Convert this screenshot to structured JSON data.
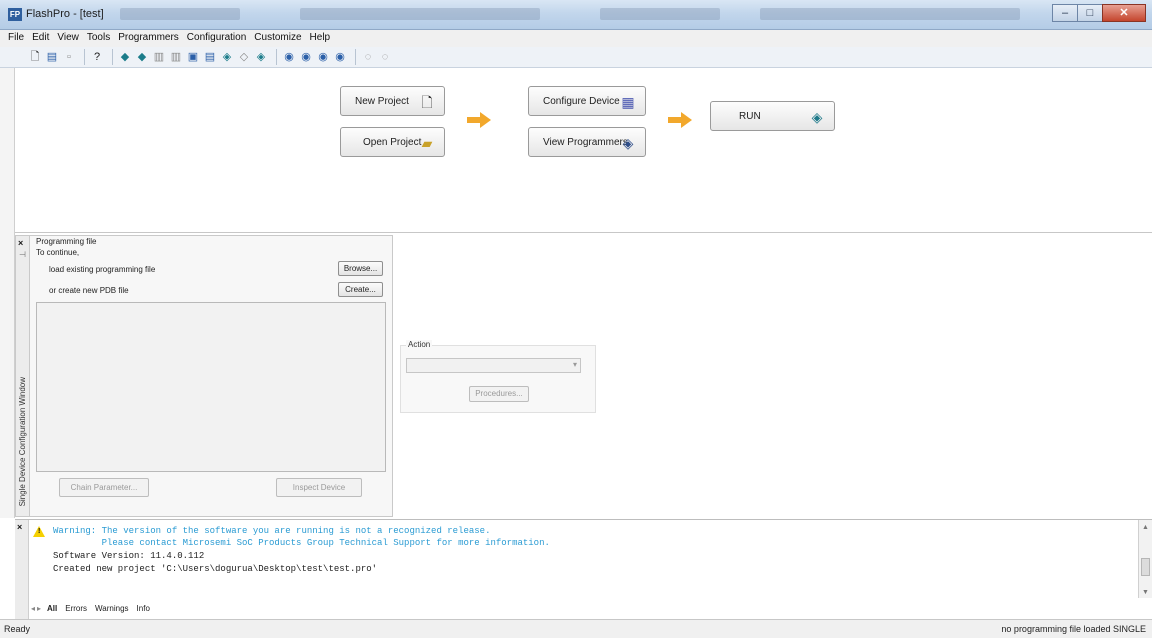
{
  "window": {
    "title": "FlashPro - [test]",
    "icon": "FP"
  },
  "menu": [
    "File",
    "Edit",
    "View",
    "Tools",
    "Programmers",
    "Configuration",
    "Customize",
    "Help"
  ],
  "toolbar_icons": [
    "new-icon",
    "open-icon",
    "save-icon",
    "help-icon",
    "programmer-icon",
    "programmer2-icon",
    "device-icon",
    "device2-icon",
    "view-icon",
    "view2-icon",
    "run-icon",
    "chain-icon",
    "scan-icon",
    "prog-a-icon",
    "prog-b-icon",
    "prog-c-icon",
    "prog-d-icon",
    "stop-icon",
    "gray-icon"
  ],
  "workflow": {
    "new_project": "New Project",
    "open_project": "Open Project",
    "configure_device": "Configure Device",
    "view_programmers": "View Programmers",
    "run": "RUN"
  },
  "programming_panel": {
    "section_title": "Programming file",
    "to_continue": "To continue,",
    "load_label": "load existing programming file",
    "browse_button": "Browse...",
    "create_label": "or create new PDB file",
    "create_button": "Create...",
    "chain_parameter_button": "Chain Parameter...",
    "inspect_device_button": "Inspect Device",
    "window_title": "Single Device Configuration Window"
  },
  "action_panel": {
    "label": "Action",
    "selected_value": "",
    "procedures_button": "Procedures..."
  },
  "log": {
    "lines": [
      {
        "text": "Warning: The version of the software you are running is not a recognized release.",
        "type": "warn"
      },
      {
        "text": "         Please contact Microsemi SoC Products Group Technical Support for more information.",
        "type": "warn"
      },
      {
        "text": "Software Version: 11.4.0.112",
        "type": "normal"
      },
      {
        "text": "Created new project 'C:\\Users\\dogurua\\Desktop\\test\\test.pro'",
        "type": "normal"
      }
    ],
    "tabs": [
      "All",
      "Errors",
      "Warnings",
      "Info"
    ]
  },
  "status": {
    "left": "Ready",
    "right": "no programming file loaded  SINGLE"
  },
  "colors": {
    "accent_arrow": "#f2a82c",
    "warning_text": "#2a9bd3"
  }
}
